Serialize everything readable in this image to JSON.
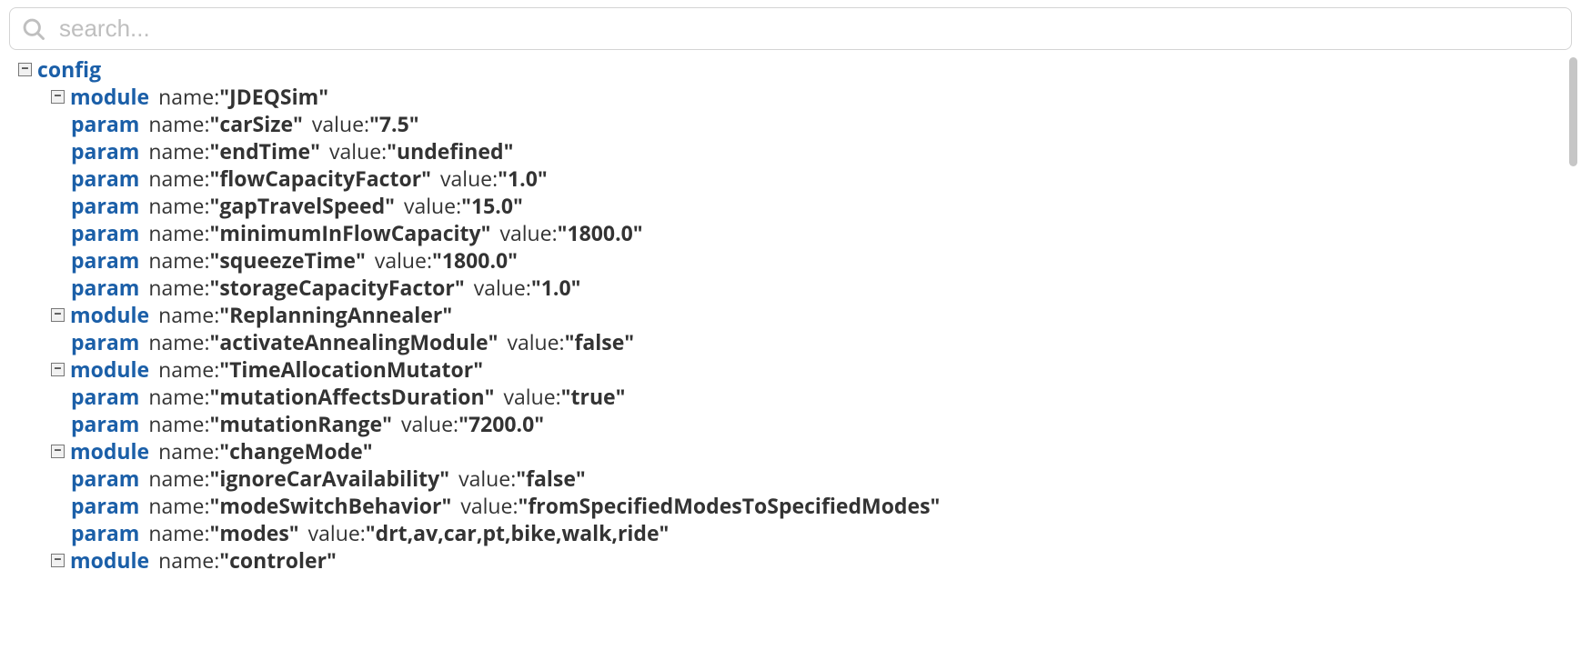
{
  "search": {
    "placeholder": "search..."
  },
  "labels": {
    "name": "name:",
    "value": "value:",
    "tag_config": "config",
    "tag_module": "module",
    "tag_param": "param"
  },
  "tree": {
    "tag": "config",
    "modules": [
      {
        "name": "JDEQSim",
        "params": [
          {
            "name": "carSize",
            "value": "7.5"
          },
          {
            "name": "endTime",
            "value": "undefined"
          },
          {
            "name": "flowCapacityFactor",
            "value": "1.0"
          },
          {
            "name": "gapTravelSpeed",
            "value": "15.0"
          },
          {
            "name": "minimumInFlowCapacity",
            "value": "1800.0"
          },
          {
            "name": "squeezeTime",
            "value": "1800.0"
          },
          {
            "name": "storageCapacityFactor",
            "value": "1.0"
          }
        ]
      },
      {
        "name": "ReplanningAnnealer",
        "params": [
          {
            "name": "activateAnnealingModule",
            "value": "false"
          }
        ]
      },
      {
        "name": "TimeAllocationMutator",
        "params": [
          {
            "name": "mutationAffectsDuration",
            "value": "true"
          },
          {
            "name": "mutationRange",
            "value": "7200.0"
          }
        ]
      },
      {
        "name": "changeMode",
        "params": [
          {
            "name": "ignoreCarAvailability",
            "value": "false"
          },
          {
            "name": "modeSwitchBehavior",
            "value": "fromSpecifiedModesToSpecifiedModes"
          },
          {
            "name": "modes",
            "value": "drt,av,car,pt,bike,walk,ride"
          }
        ]
      },
      {
        "name": "controler",
        "params": []
      }
    ]
  }
}
